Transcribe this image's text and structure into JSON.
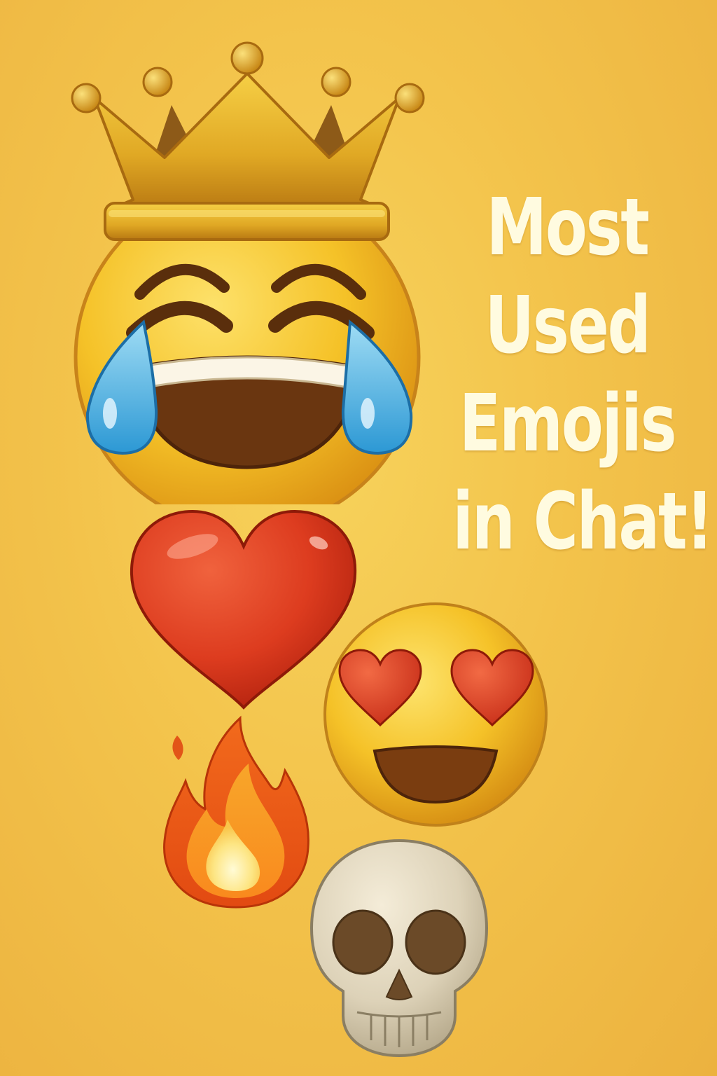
{
  "title_lines": [
    "Most",
    "Used",
    "Emojis",
    "in Chat!"
  ],
  "emojis": [
    {
      "icon": "crowned-face-with-tears-of-joy-icon"
    },
    {
      "icon": "red-heart-icon"
    },
    {
      "icon": "smiling-face-with-heart-eyes-icon"
    },
    {
      "icon": "fire-icon"
    },
    {
      "icon": "skull-icon"
    }
  ],
  "colors": {
    "background": "#f3c34b",
    "title_text": "#fffbe0",
    "face_yellow": "#f5c228",
    "heart_red": "#e0391f",
    "tear_blue": "#3aaee0"
  }
}
